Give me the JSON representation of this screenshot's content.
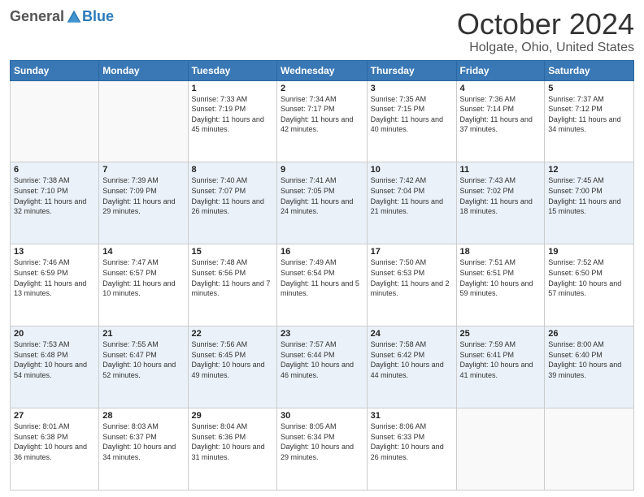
{
  "header": {
    "logo_general": "General",
    "logo_blue": "Blue",
    "month": "October 2024",
    "location": "Holgate, Ohio, United States"
  },
  "days_of_week": [
    "Sunday",
    "Monday",
    "Tuesday",
    "Wednesday",
    "Thursday",
    "Friday",
    "Saturday"
  ],
  "weeks": [
    [
      {
        "day": "",
        "sunrise": "",
        "sunset": "",
        "daylight": ""
      },
      {
        "day": "",
        "sunrise": "",
        "sunset": "",
        "daylight": ""
      },
      {
        "day": "1",
        "sunrise": "Sunrise: 7:33 AM",
        "sunset": "Sunset: 7:19 PM",
        "daylight": "Daylight: 11 hours and 45 minutes."
      },
      {
        "day": "2",
        "sunrise": "Sunrise: 7:34 AM",
        "sunset": "Sunset: 7:17 PM",
        "daylight": "Daylight: 11 hours and 42 minutes."
      },
      {
        "day": "3",
        "sunrise": "Sunrise: 7:35 AM",
        "sunset": "Sunset: 7:15 PM",
        "daylight": "Daylight: 11 hours and 40 minutes."
      },
      {
        "day": "4",
        "sunrise": "Sunrise: 7:36 AM",
        "sunset": "Sunset: 7:14 PM",
        "daylight": "Daylight: 11 hours and 37 minutes."
      },
      {
        "day": "5",
        "sunrise": "Sunrise: 7:37 AM",
        "sunset": "Sunset: 7:12 PM",
        "daylight": "Daylight: 11 hours and 34 minutes."
      }
    ],
    [
      {
        "day": "6",
        "sunrise": "Sunrise: 7:38 AM",
        "sunset": "Sunset: 7:10 PM",
        "daylight": "Daylight: 11 hours and 32 minutes."
      },
      {
        "day": "7",
        "sunrise": "Sunrise: 7:39 AM",
        "sunset": "Sunset: 7:09 PM",
        "daylight": "Daylight: 11 hours and 29 minutes."
      },
      {
        "day": "8",
        "sunrise": "Sunrise: 7:40 AM",
        "sunset": "Sunset: 7:07 PM",
        "daylight": "Daylight: 11 hours and 26 minutes."
      },
      {
        "day": "9",
        "sunrise": "Sunrise: 7:41 AM",
        "sunset": "Sunset: 7:05 PM",
        "daylight": "Daylight: 11 hours and 24 minutes."
      },
      {
        "day": "10",
        "sunrise": "Sunrise: 7:42 AM",
        "sunset": "Sunset: 7:04 PM",
        "daylight": "Daylight: 11 hours and 21 minutes."
      },
      {
        "day": "11",
        "sunrise": "Sunrise: 7:43 AM",
        "sunset": "Sunset: 7:02 PM",
        "daylight": "Daylight: 11 hours and 18 minutes."
      },
      {
        "day": "12",
        "sunrise": "Sunrise: 7:45 AM",
        "sunset": "Sunset: 7:00 PM",
        "daylight": "Daylight: 11 hours and 15 minutes."
      }
    ],
    [
      {
        "day": "13",
        "sunrise": "Sunrise: 7:46 AM",
        "sunset": "Sunset: 6:59 PM",
        "daylight": "Daylight: 11 hours and 13 minutes."
      },
      {
        "day": "14",
        "sunrise": "Sunrise: 7:47 AM",
        "sunset": "Sunset: 6:57 PM",
        "daylight": "Daylight: 11 hours and 10 minutes."
      },
      {
        "day": "15",
        "sunrise": "Sunrise: 7:48 AM",
        "sunset": "Sunset: 6:56 PM",
        "daylight": "Daylight: 11 hours and 7 minutes."
      },
      {
        "day": "16",
        "sunrise": "Sunrise: 7:49 AM",
        "sunset": "Sunset: 6:54 PM",
        "daylight": "Daylight: 11 hours and 5 minutes."
      },
      {
        "day": "17",
        "sunrise": "Sunrise: 7:50 AM",
        "sunset": "Sunset: 6:53 PM",
        "daylight": "Daylight: 11 hours and 2 minutes."
      },
      {
        "day": "18",
        "sunrise": "Sunrise: 7:51 AM",
        "sunset": "Sunset: 6:51 PM",
        "daylight": "Daylight: 10 hours and 59 minutes."
      },
      {
        "day": "19",
        "sunrise": "Sunrise: 7:52 AM",
        "sunset": "Sunset: 6:50 PM",
        "daylight": "Daylight: 10 hours and 57 minutes."
      }
    ],
    [
      {
        "day": "20",
        "sunrise": "Sunrise: 7:53 AM",
        "sunset": "Sunset: 6:48 PM",
        "daylight": "Daylight: 10 hours and 54 minutes."
      },
      {
        "day": "21",
        "sunrise": "Sunrise: 7:55 AM",
        "sunset": "Sunset: 6:47 PM",
        "daylight": "Daylight: 10 hours and 52 minutes."
      },
      {
        "day": "22",
        "sunrise": "Sunrise: 7:56 AM",
        "sunset": "Sunset: 6:45 PM",
        "daylight": "Daylight: 10 hours and 49 minutes."
      },
      {
        "day": "23",
        "sunrise": "Sunrise: 7:57 AM",
        "sunset": "Sunset: 6:44 PM",
        "daylight": "Daylight: 10 hours and 46 minutes."
      },
      {
        "day": "24",
        "sunrise": "Sunrise: 7:58 AM",
        "sunset": "Sunset: 6:42 PM",
        "daylight": "Daylight: 10 hours and 44 minutes."
      },
      {
        "day": "25",
        "sunrise": "Sunrise: 7:59 AM",
        "sunset": "Sunset: 6:41 PM",
        "daylight": "Daylight: 10 hours and 41 minutes."
      },
      {
        "day": "26",
        "sunrise": "Sunrise: 8:00 AM",
        "sunset": "Sunset: 6:40 PM",
        "daylight": "Daylight: 10 hours and 39 minutes."
      }
    ],
    [
      {
        "day": "27",
        "sunrise": "Sunrise: 8:01 AM",
        "sunset": "Sunset: 6:38 PM",
        "daylight": "Daylight: 10 hours and 36 minutes."
      },
      {
        "day": "28",
        "sunrise": "Sunrise: 8:03 AM",
        "sunset": "Sunset: 6:37 PM",
        "daylight": "Daylight: 10 hours and 34 minutes."
      },
      {
        "day": "29",
        "sunrise": "Sunrise: 8:04 AM",
        "sunset": "Sunset: 6:36 PM",
        "daylight": "Daylight: 10 hours and 31 minutes."
      },
      {
        "day": "30",
        "sunrise": "Sunrise: 8:05 AM",
        "sunset": "Sunset: 6:34 PM",
        "daylight": "Daylight: 10 hours and 29 minutes."
      },
      {
        "day": "31",
        "sunrise": "Sunrise: 8:06 AM",
        "sunset": "Sunset: 6:33 PM",
        "daylight": "Daylight: 10 hours and 26 minutes."
      },
      {
        "day": "",
        "sunrise": "",
        "sunset": "",
        "daylight": ""
      },
      {
        "day": "",
        "sunrise": "",
        "sunset": "",
        "daylight": ""
      }
    ]
  ]
}
